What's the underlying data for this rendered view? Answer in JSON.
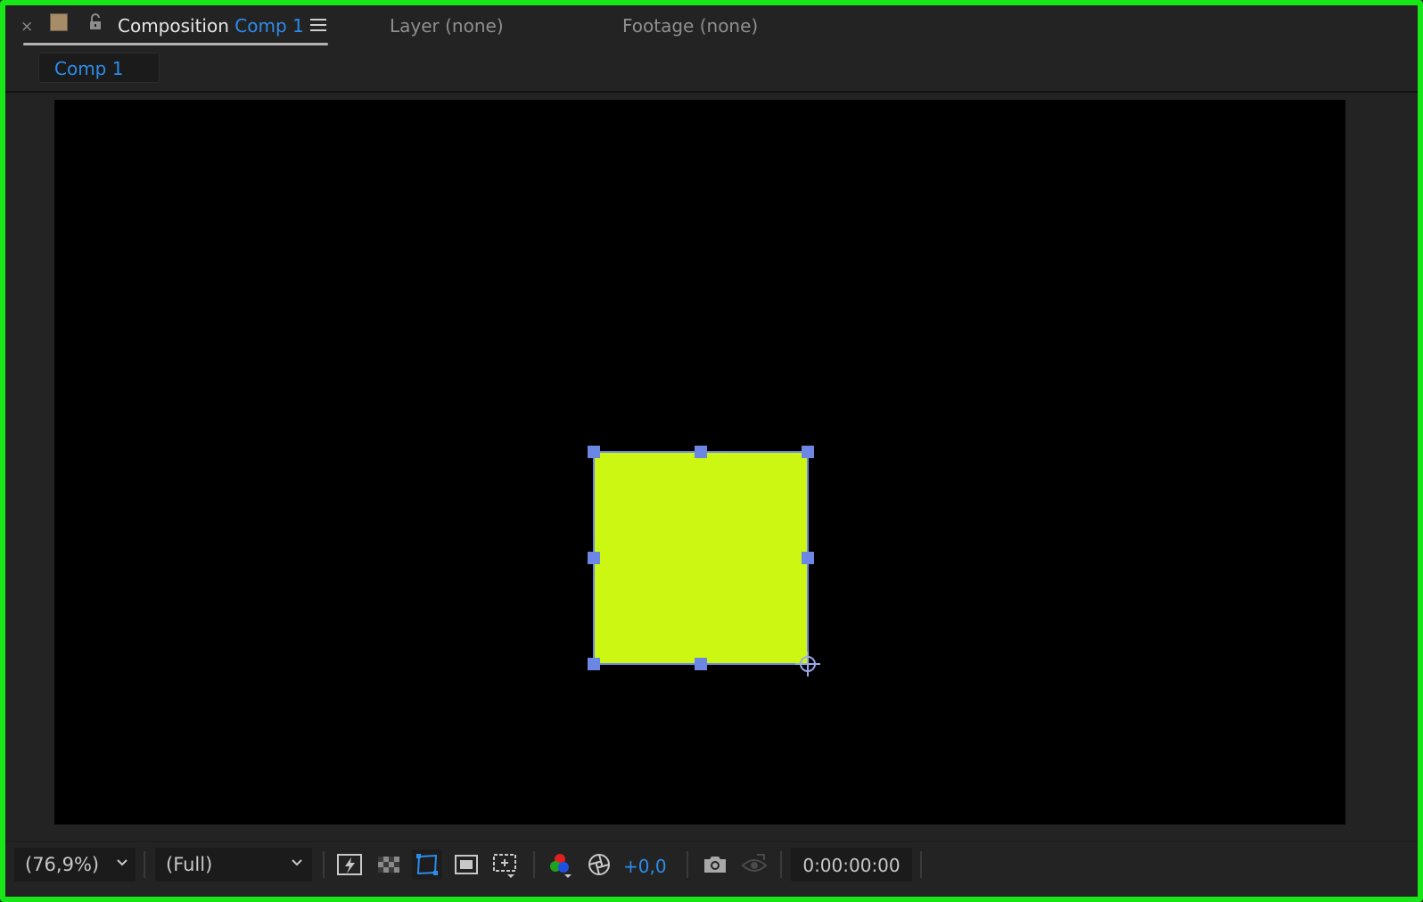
{
  "header": {
    "close_glyph": "×",
    "composition_label": "Composition",
    "comp_name": "Comp 1",
    "menu_icon": "hamburger-menu-icon",
    "layer_tab": "Layer (none)",
    "footage_tab": "Footage (none)"
  },
  "breadcrumb": {
    "label": "Comp 1"
  },
  "layer": {
    "fill_color": "#ccf712",
    "handle_color": "#6c87e3",
    "outline_color": "#6c87e3",
    "background": "#000000"
  },
  "toolbar": {
    "zoom": "(76,9%)",
    "resolution": "(Full)",
    "exposure": "+0,0",
    "timecode": "0:00:00:00",
    "icons": [
      "fast-previews-icon",
      "transparency-grid-icon",
      "mask-path-visibility-icon",
      "region-of-interest-icon",
      "grid-guides-icon",
      "color-channels-icon",
      "color-management-icon",
      "snapshot-camera-icon",
      "show-snapshot-icon"
    ]
  },
  "colors": {
    "accent_blue": "#2d8ceb",
    "panel_border": "#18e618",
    "panel_bg": "#232323"
  }
}
